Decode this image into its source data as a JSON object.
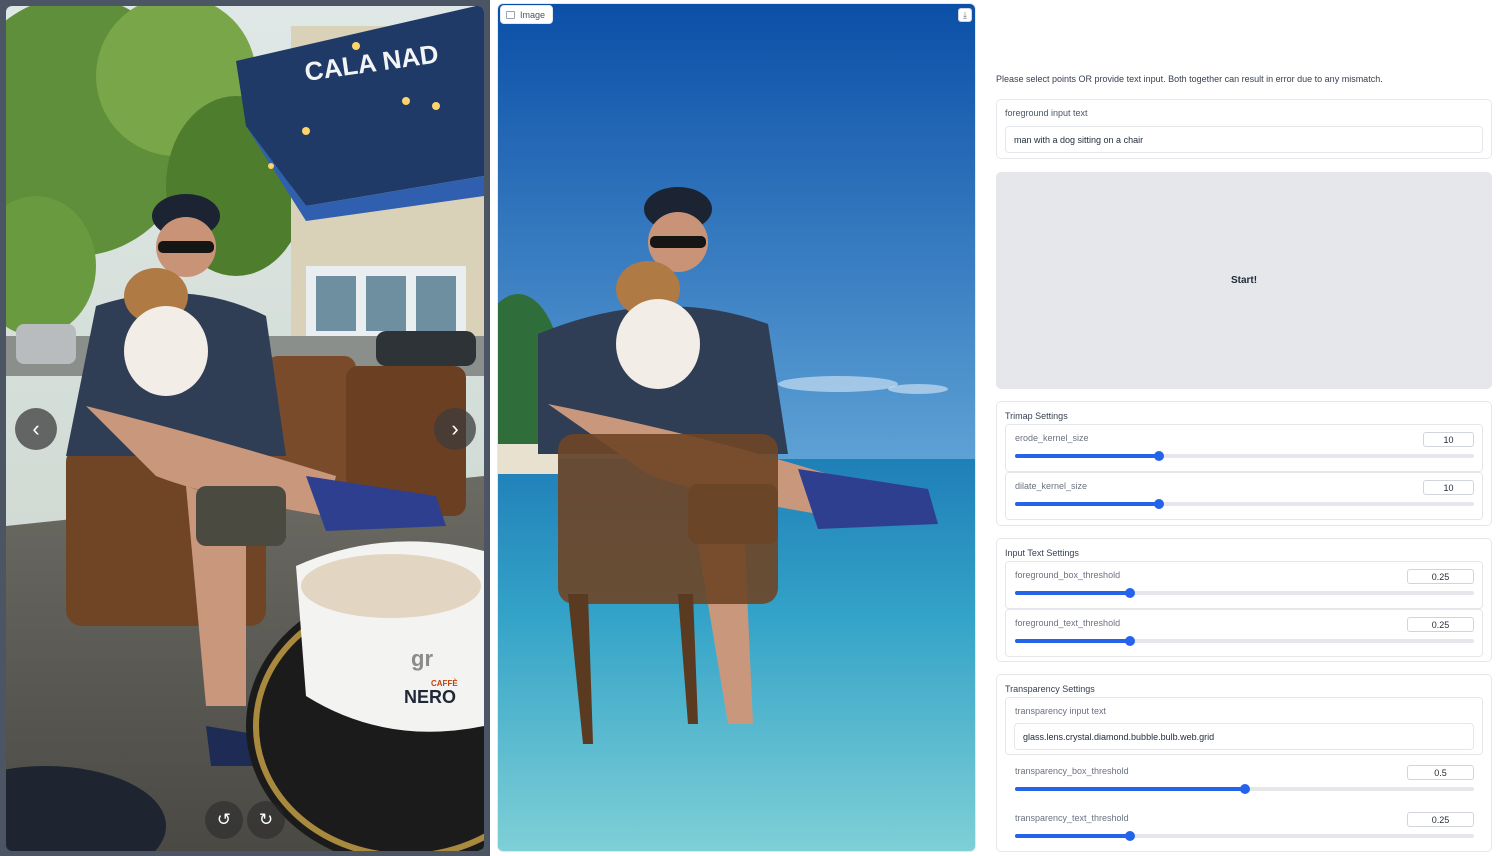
{
  "gallery": {
    "prev_icon": "‹",
    "next_icon": "›",
    "rotate_ccw_icon": "↺",
    "rotate_cw_icon": "↻",
    "photo_text": {
      "awning": "CALA NAD",
      "cup_brand": "gr",
      "cup_name": "NERO",
      "cup_small": "CAFFÈ"
    }
  },
  "output_image": {
    "label": "Image",
    "download_icon": "⤓"
  },
  "controls": {
    "hint": "Please select points OR provide text input. Both together can result in error due to any mismatch.",
    "foreground_input": {
      "label": "foreground input text",
      "value": "man with a dog sitting on a chair"
    },
    "start_label": "Start!",
    "trimap": {
      "title": "Trimap Settings",
      "sliders": [
        {
          "name": "erode_kernel_size",
          "value": "10",
          "fraction": 0.313
        },
        {
          "name": "dilate_kernel_size",
          "value": "10",
          "fraction": 0.313
        }
      ]
    },
    "input_text": {
      "title": "Input Text Settings",
      "sliders": [
        {
          "name": "foreground_box_threshold",
          "value": "0.25",
          "fraction": 0.25
        },
        {
          "name": "foreground_text_threshold",
          "value": "0.25",
          "fraction": 0.25
        }
      ]
    },
    "transparency": {
      "title": "Transparency Settings",
      "input": {
        "label": "transparency input text",
        "value": "glass.lens.crystal.diamond.bubble.bulb.web.grid"
      },
      "sliders": [
        {
          "name": "transparency_box_threshold",
          "value": "0.5",
          "fraction": 0.5
        },
        {
          "name": "transparency_text_threshold",
          "value": "0.25",
          "fraction": 0.25
        }
      ]
    }
  }
}
